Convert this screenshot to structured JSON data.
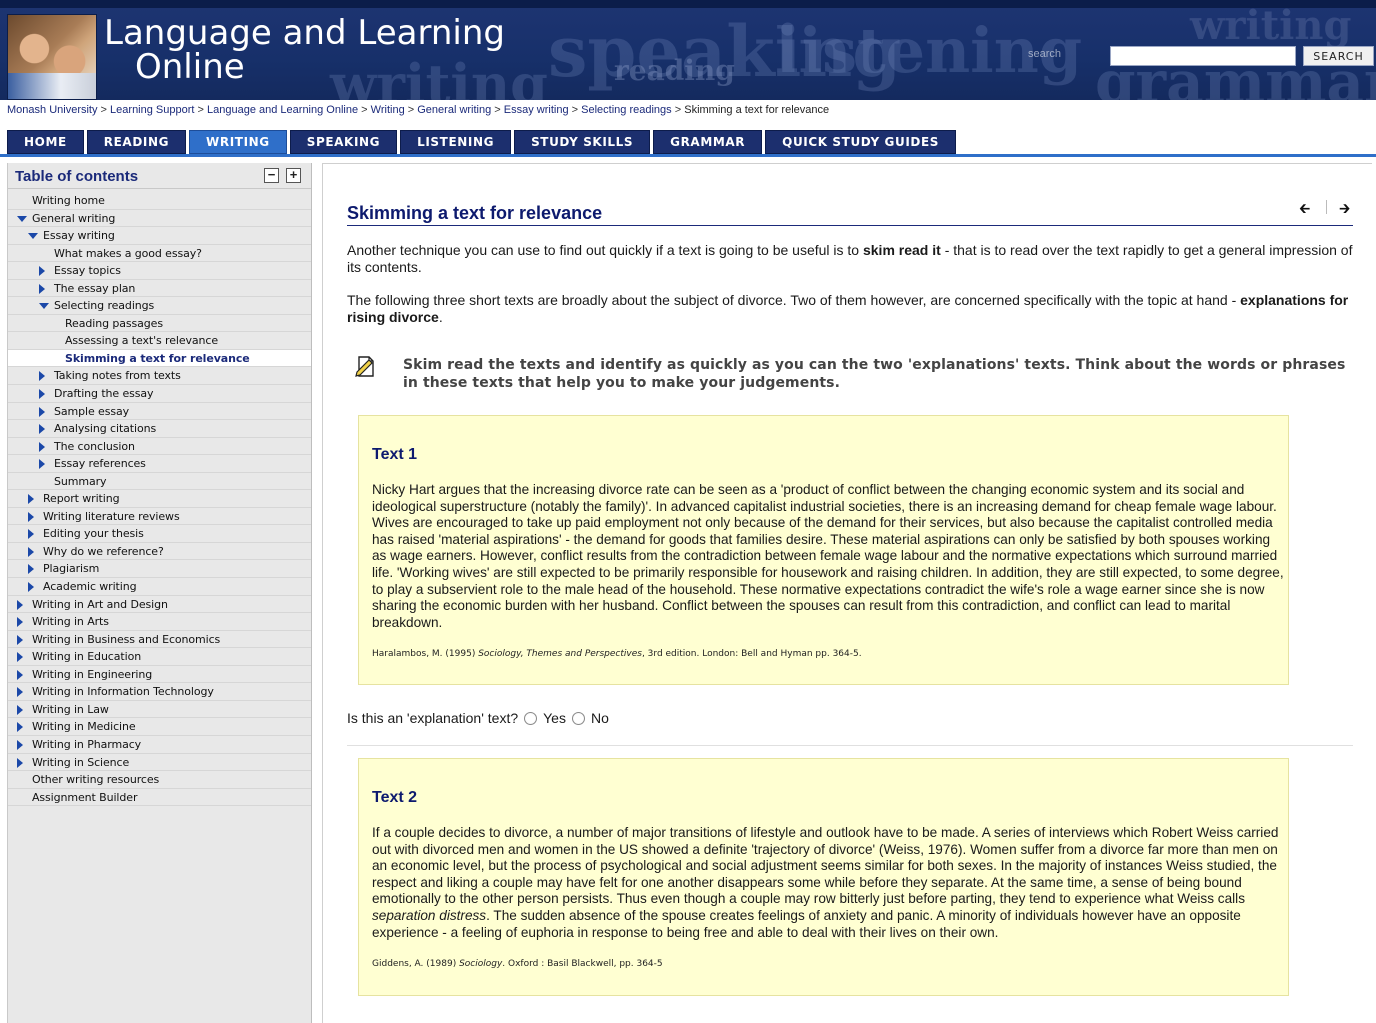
{
  "header": {
    "title_line1": "Language and Learning",
    "title_line2": "Online",
    "watermarks": [
      "speaking",
      "writing",
      "reading",
      "listening",
      "writing",
      "grammar"
    ],
    "search_label": "search",
    "search_placeholder": "",
    "search_button": "SEARCH"
  },
  "breadcrumb": {
    "items": [
      "Monash University",
      "Learning Support",
      "Language and Learning Online",
      "Writing",
      "General writing",
      "Essay writing",
      "Selecting readings"
    ],
    "separator": ">",
    "current": "Skimming a text for relevance"
  },
  "nav": {
    "tabs": [
      "HOME",
      "READING",
      "WRITING",
      "SPEAKING",
      "LISTENING",
      "STUDY SKILLS",
      "GRAMMAR",
      "QUICK STUDY GUIDES"
    ],
    "active": "WRITING"
  },
  "sidebar": {
    "title": "Table of contents",
    "collapse_label": "−",
    "expand_label": "+",
    "items": [
      {
        "label": "Writing home",
        "level": 0,
        "icon": "none"
      },
      {
        "label": "General writing",
        "level": 0,
        "icon": "expanded"
      },
      {
        "label": "Essay writing",
        "level": 1,
        "icon": "expanded"
      },
      {
        "label": "What makes a good essay?",
        "level": 2,
        "icon": "none"
      },
      {
        "label": "Essay topics",
        "level": 2,
        "icon": "collapsed"
      },
      {
        "label": "The essay plan",
        "level": 2,
        "icon": "collapsed"
      },
      {
        "label": "Selecting readings",
        "level": 2,
        "icon": "expanded"
      },
      {
        "label": "Reading passages",
        "level": 3,
        "icon": "none"
      },
      {
        "label": "Assessing a text's relevance",
        "level": 3,
        "icon": "none"
      },
      {
        "label": "Skimming a text for relevance",
        "level": 3,
        "icon": "none",
        "active": true
      },
      {
        "label": "Taking notes from texts",
        "level": 2,
        "icon": "collapsed"
      },
      {
        "label": "Drafting the essay",
        "level": 2,
        "icon": "collapsed"
      },
      {
        "label": "Sample essay",
        "level": 2,
        "icon": "collapsed"
      },
      {
        "label": "Analysing citations",
        "level": 2,
        "icon": "collapsed"
      },
      {
        "label": "The conclusion",
        "level": 2,
        "icon": "collapsed"
      },
      {
        "label": "Essay references",
        "level": 2,
        "icon": "collapsed"
      },
      {
        "label": "Summary",
        "level": 2,
        "icon": "none"
      },
      {
        "label": "Report writing",
        "level": 1,
        "icon": "collapsed"
      },
      {
        "label": "Writing literature reviews",
        "level": 1,
        "icon": "collapsed"
      },
      {
        "label": "Editing your thesis",
        "level": 1,
        "icon": "collapsed"
      },
      {
        "label": "Why do we reference?",
        "level": 1,
        "icon": "collapsed"
      },
      {
        "label": "Plagiarism",
        "level": 1,
        "icon": "collapsed"
      },
      {
        "label": "Academic writing",
        "level": 1,
        "icon": "collapsed"
      },
      {
        "label": "Writing in Art and Design",
        "level": 0,
        "icon": "collapsed"
      },
      {
        "label": "Writing in Arts",
        "level": 0,
        "icon": "collapsed"
      },
      {
        "label": "Writing in Business and Economics",
        "level": 0,
        "icon": "collapsed"
      },
      {
        "label": "Writing in Education",
        "level": 0,
        "icon": "collapsed"
      },
      {
        "label": "Writing in Engineering",
        "level": 0,
        "icon": "collapsed"
      },
      {
        "label": "Writing in Information Technology",
        "level": 0,
        "icon": "collapsed"
      },
      {
        "label": "Writing in Law",
        "level": 0,
        "icon": "collapsed"
      },
      {
        "label": "Writing in Medicine",
        "level": 0,
        "icon": "collapsed"
      },
      {
        "label": "Writing in Pharmacy",
        "level": 0,
        "icon": "collapsed"
      },
      {
        "label": "Writing in Science",
        "level": 0,
        "icon": "collapsed"
      },
      {
        "label": "Other writing resources",
        "level": 0,
        "icon": "none"
      },
      {
        "label": "Assignment Builder",
        "level": 0,
        "icon": "none"
      }
    ]
  },
  "main": {
    "title": "Skimming a text for relevance",
    "prev_icon": "arrow-left-icon",
    "next_icon": "arrow-right-icon",
    "para1_a": "Another technique you can use to find out quickly if a text is going to be useful is to ",
    "para1_b": "skim read it",
    "para1_c": " - that is to read over the text rapidly to get a general impression of its contents.",
    "para2_a": "The following three short texts are broadly about the subject of divorce. Two of them however, are concerned specifically with the topic at hand - ",
    "para2_b": "explanations for rising divorce",
    "para2_c": ".",
    "task_icon": "note-pencil-icon",
    "task": "Skim read the texts and identify as quickly as you can the two 'explanations' texts. Think about the words or phrases in these texts that help you to make your judgements.",
    "text1": {
      "title": "Text 1",
      "body": "Nicky Hart argues that the increasing divorce rate can be seen as a 'product of conflict between the changing economic system and its social and ideological superstructure (notably the family)'. In advanced capitalist industrial societies, there is an increasing demand for cheap female wage labour. Wives are encouraged to take up paid employment not only because of the demand for their services, but also because the capitalist controlled media has raised 'material aspirations' - the demand for goods that families desire. These material aspirations can only be satisfied by both spouses working as wage earners. However, conflict results from the contradiction between female wage labour and the normative expectations which surround married life. 'Working wives' are still expected to be primarily responsible for housework and raising children. In addition, they are still expected, to some degree, to play a subservient role to the male head of the household. These normative expectations contradict the wife's role a wage earner since she is now sharing the economic burden with her husband. Conflict between the spouses can result from this contradiction, and conflict can lead to marital breakdown.",
      "cite_a": "Haralambos, M. (1995) ",
      "cite_b": "Sociology, Themes and Perspectives",
      "cite_c": ", 3rd edition. London: Bell and Hyman pp. 364-5."
    },
    "question": {
      "label": "Is this an 'explanation' text?",
      "options": [
        "Yes",
        "No"
      ],
      "selected": null
    },
    "text2": {
      "title": "Text 2",
      "body_a": "If a couple decides to divorce, a number of major transitions of lifestyle and outlook have to be made. A series of interviews which Robert Weiss carried out with divorced men and women in the US showed a definite 'trajectory of divorce' (Weiss, 1976). Women suffer from a divorce far more than men on an economic level, but the process of psychological and social adjustment seems similar for both sexes. In the majority of instances Weiss studied, the respect and liking a couple may have felt for one another disappears some while before they separate. At the same time, a sense of being bound emotionally to the other person persists. Thus even though a couple may row bitterly just before parting, they tend to experience what Weiss calls ",
      "body_b": "separation distress",
      "body_c": ". The sudden absence of the spouse creates feelings of anxiety and panic. A minority of individuals however have an opposite experience - a feeling of euphoria in response to being free and able to deal with their lives on their own.",
      "cite_a": "Giddens, A. (1989) ",
      "cite_b": "Sociology",
      "cite_c": ". Oxford : Basil Blackwell, pp. 364-5"
    }
  },
  "colors": {
    "banner": "#17306a",
    "tab": "#1c2f6e",
    "tab_active": "#2f6fc9",
    "heading": "#0d1a6e",
    "textbox": "#ffffd2"
  }
}
